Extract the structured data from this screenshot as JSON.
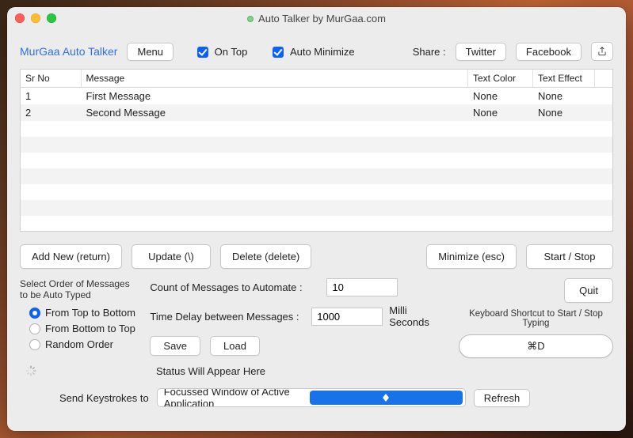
{
  "window": {
    "title": "Auto Talker by MurGaa.com"
  },
  "topbar": {
    "app_link": "MurGaa Auto Talker",
    "menu_label": "Menu",
    "on_top_label": "On Top",
    "on_top_checked": true,
    "auto_minimize_label": "Auto Minimize",
    "auto_minimize_checked": true,
    "share_label": "Share :",
    "twitter_label": "Twitter",
    "facebook_label": "Facebook"
  },
  "table": {
    "headers": {
      "sr": "Sr No",
      "msg": "Message",
      "tc": "Text Color",
      "te": "Text Effect"
    },
    "rows": [
      {
        "sr": "1",
        "msg": "First Message",
        "tc": "None",
        "te": "None"
      },
      {
        "sr": "2",
        "msg": "Second Message",
        "tc": "None",
        "te": "None"
      }
    ]
  },
  "actions": {
    "add": "Add New (return)",
    "update": "Update (\\)",
    "delete": "Delete (delete)",
    "minimize": "Minimize (esc)",
    "startstop": "Start / Stop",
    "quit": "Quit"
  },
  "order": {
    "title": "Select Order of Messages to be Auto Typed",
    "opt1": "From Top to Bottom",
    "opt2": "From Bottom to Top",
    "opt3": "Random Order",
    "selected": 0
  },
  "settings": {
    "count_label": "Count of Messages to Automate :",
    "count_value": "10",
    "delay_label": "Time Delay between Messages :",
    "delay_value": "1000",
    "delay_unit": "Milli Seconds",
    "save_label": "Save",
    "load_label": "Load"
  },
  "keyboard": {
    "title": "Keyboard Shortcut to Start / Stop Typing",
    "shortcut": "⌘D"
  },
  "status": {
    "text": "Status Will Appear Here"
  },
  "bottom": {
    "label": "Send Keystrokes to",
    "combo_value": "Focussed Window of Active Application",
    "refresh": "Refresh"
  }
}
